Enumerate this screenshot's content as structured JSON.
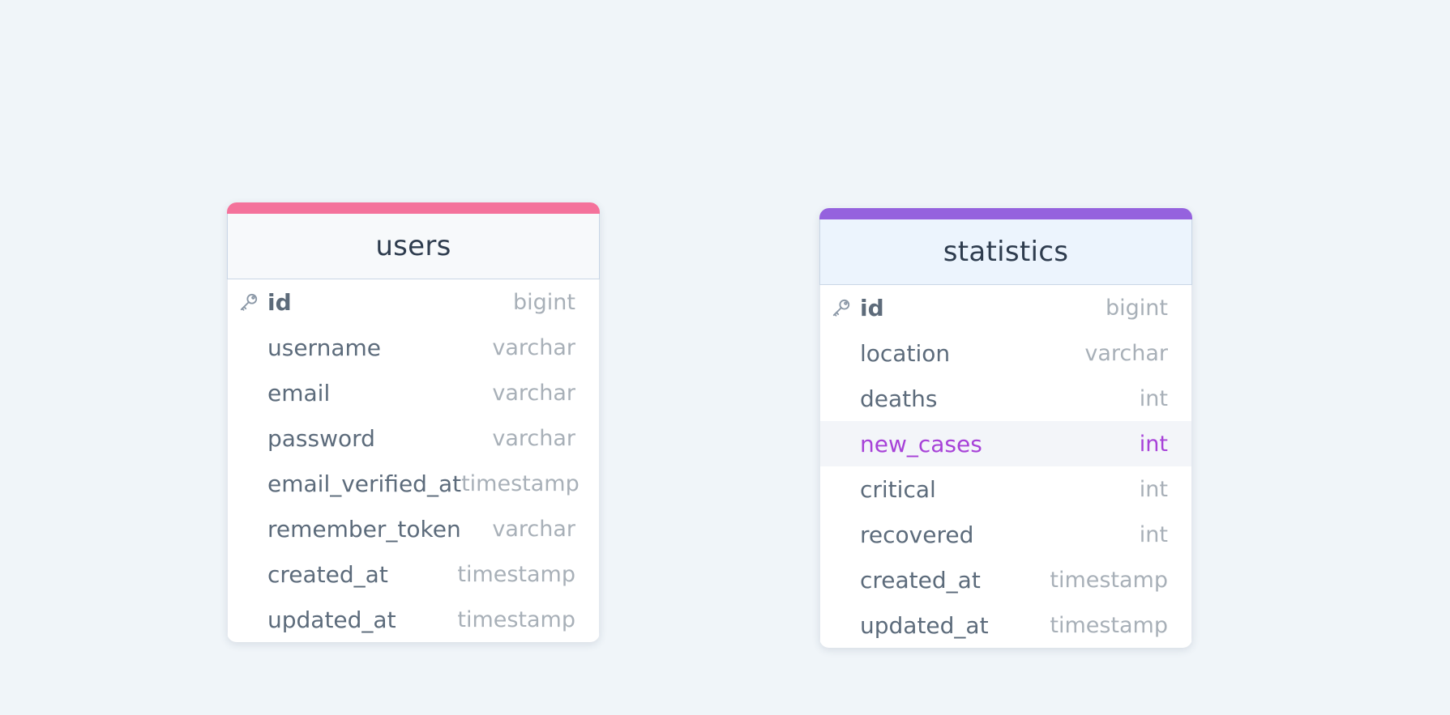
{
  "tables": [
    {
      "id": "users",
      "name": "users",
      "accent_color": "#f4729b",
      "header_bg": "#f7f9fb",
      "columns": [
        {
          "name": "id",
          "type": "bigint",
          "primary_key": true,
          "icon": "key-icon"
        },
        {
          "name": "username",
          "type": "varchar"
        },
        {
          "name": "email",
          "type": "varchar"
        },
        {
          "name": "password",
          "type": "varchar"
        },
        {
          "name": "email_verified_at",
          "type": "timestamp"
        },
        {
          "name": "remember_token",
          "type": "varchar"
        },
        {
          "name": "created_at",
          "type": "timestamp"
        },
        {
          "name": "updated_at",
          "type": "timestamp"
        }
      ]
    },
    {
      "id": "statistics",
      "name": "statistics",
      "accent_color": "#9562de",
      "header_bg": "#ecf4fd",
      "columns": [
        {
          "name": "id",
          "type": "bigint",
          "primary_key": true,
          "icon": "key-icon"
        },
        {
          "name": "location",
          "type": "varchar"
        },
        {
          "name": "deaths",
          "type": "int"
        },
        {
          "name": "new_cases",
          "type": "int",
          "highlighted": true
        },
        {
          "name": "critical",
          "type": "int"
        },
        {
          "name": "recovered",
          "type": "int"
        },
        {
          "name": "created_at",
          "type": "timestamp"
        },
        {
          "name": "updated_at",
          "type": "timestamp"
        }
      ]
    }
  ],
  "colors": {
    "background": "#f0f5f9",
    "highlight_text": "#a742d8"
  }
}
